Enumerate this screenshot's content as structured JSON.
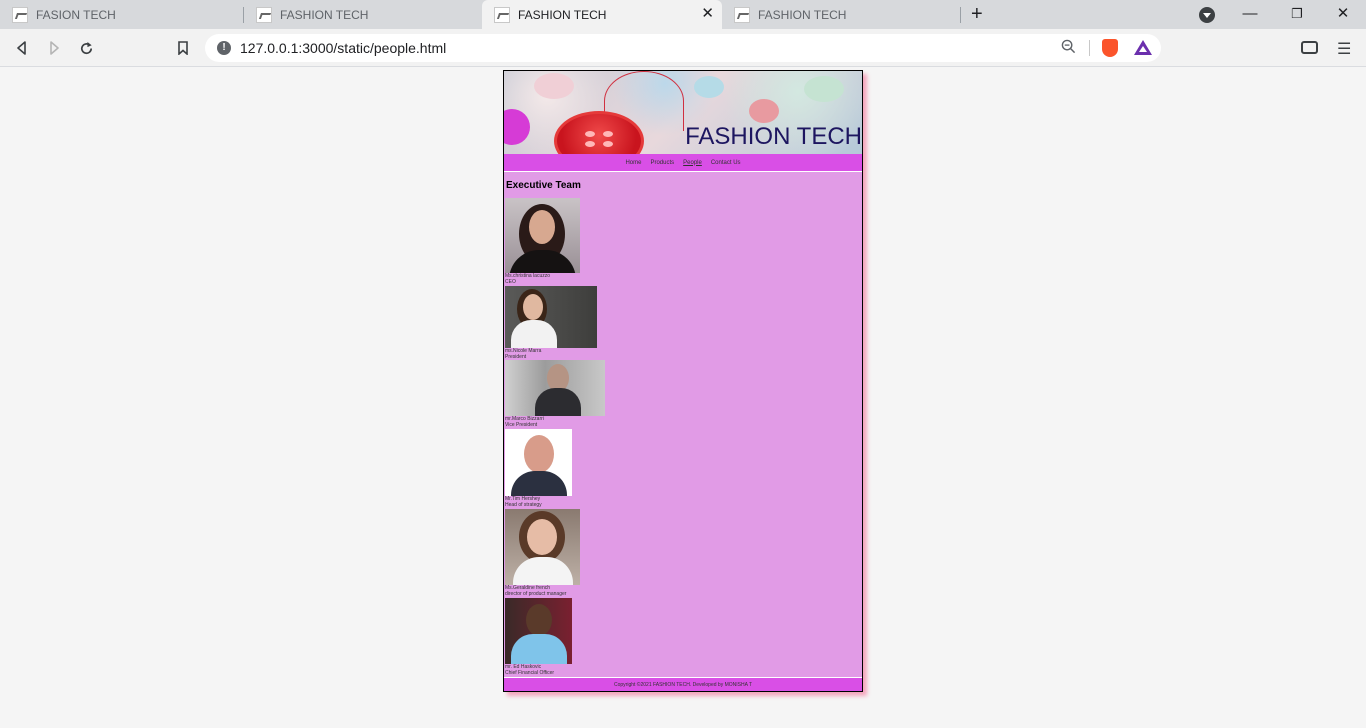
{
  "browser": {
    "tabs": [
      {
        "title": "FASION TECH",
        "active": false
      },
      {
        "title": "FASHION TECH",
        "active": false
      },
      {
        "title": "FASHION TECH",
        "active": true
      },
      {
        "title": "FASHION TECH",
        "active": false
      }
    ],
    "close_tab_glyph": "✕",
    "new_tab_glyph": "+",
    "window_controls": {
      "minimize": "—",
      "restore": "❐",
      "close": "✕"
    },
    "address": "127.0.0.1:3000/static/people.html",
    "icons": [
      "back-icon",
      "forward-icon",
      "reload-icon",
      "bookmark-icon",
      "info-icon",
      "zoom-icon",
      "brave-shields-icon",
      "brave-rewards-icon",
      "wallet-icon",
      "menu-icon"
    ]
  },
  "site": {
    "title": "FASHION TECH",
    "nav": [
      {
        "label": "Home",
        "active": false
      },
      {
        "label": "Products",
        "active": false
      },
      {
        "label": "People",
        "active": true
      },
      {
        "label": "Contact Us",
        "active": false
      }
    ],
    "section_title": "Executive Team",
    "people": [
      {
        "name": "Ms.christina lacuzzo",
        "role": "CEO"
      },
      {
        "name": "ms.Nicole Marra",
        "role": "President"
      },
      {
        "name": "mr.Marco Bizzarri",
        "role": "Vice President"
      },
      {
        "name": "Mr.Tim Hershey",
        "role": "Head of strategy"
      },
      {
        "name": "Ms.Geraldine french",
        "role": "director of product manager"
      },
      {
        "name": "mr. Ed Haskovic",
        "role": "Chief Financial Officer"
      }
    ],
    "footer": "Copyright ©2021 FASHION TECH. Developed by MONISHA T"
  },
  "colors": {
    "page_bg": "#e19be6",
    "nav_bg": "#d94fe6",
    "title_color": "#1d1660"
  }
}
